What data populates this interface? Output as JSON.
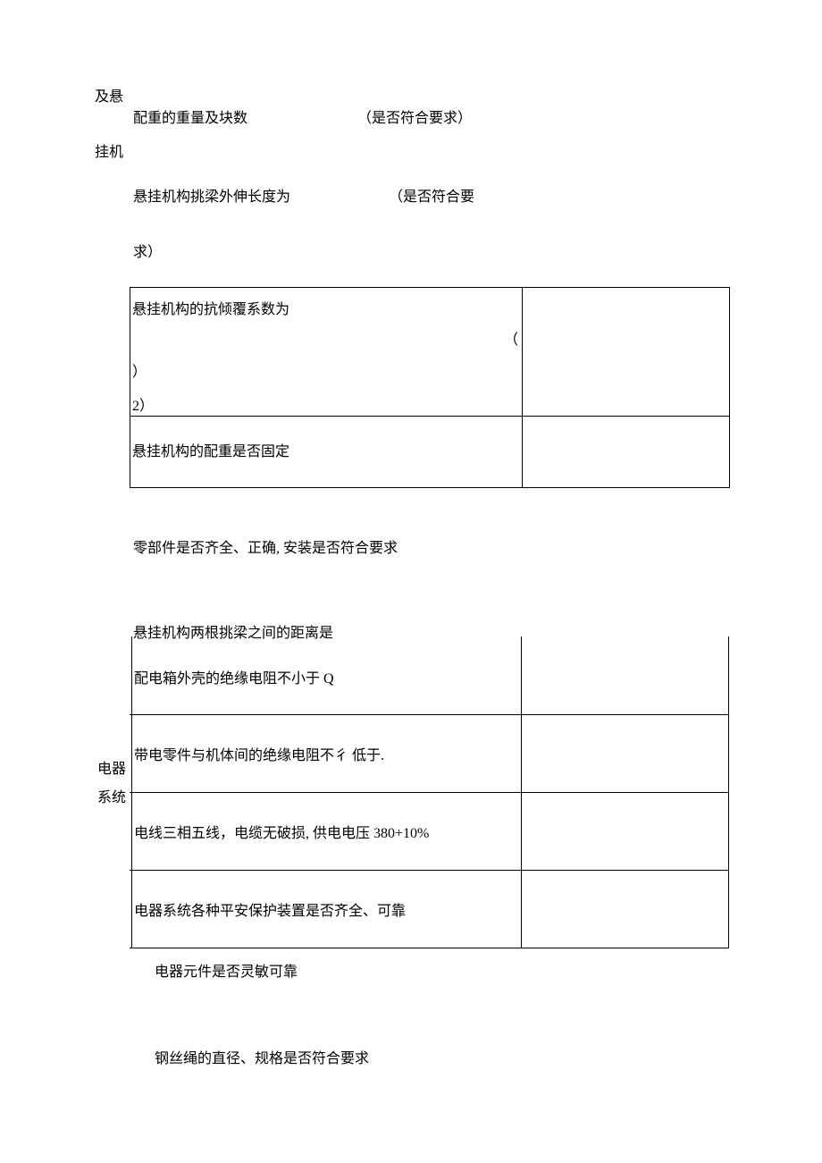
{
  "left_label_top": "及悬",
  "left_label_bottom": "挂机",
  "line1a": "配重的重量及块数",
  "line1b": "（是否符合要求）",
  "line2a": "悬挂机构挑梁外伸长度为",
  "line2b": "（是否符合要",
  "line3": "求）",
  "table1": {
    "row1_text1": "悬挂机构的抗倾覆系数为",
    "row1_paren_open": "（",
    "row1_paren_close": "）",
    "row1_text2": "2）",
    "row2_text": "悬挂机构的配重是否固定"
  },
  "line4": "零部件是否齐全、正确, 安装是否符合要求",
  "line5": "悬挂机构两根挑梁之间的距离是",
  "left_label2_a": "电器",
  "left_label2_b": "系统",
  "table2": {
    "row1": "配电箱外壳的绝缘电阻不小于 Q",
    "row2": "带电零件与机体间的绝缘电阻不彳 低于.",
    "row3": "电线三相五线，电缆无破损, 供电电压 380+10%",
    "row4": "电器系统各种平安保护装置是否齐全、可靠"
  },
  "line6": "电器元件是否灵敏可靠",
  "line7": "钢丝绳的直径、规格是否符合要求"
}
